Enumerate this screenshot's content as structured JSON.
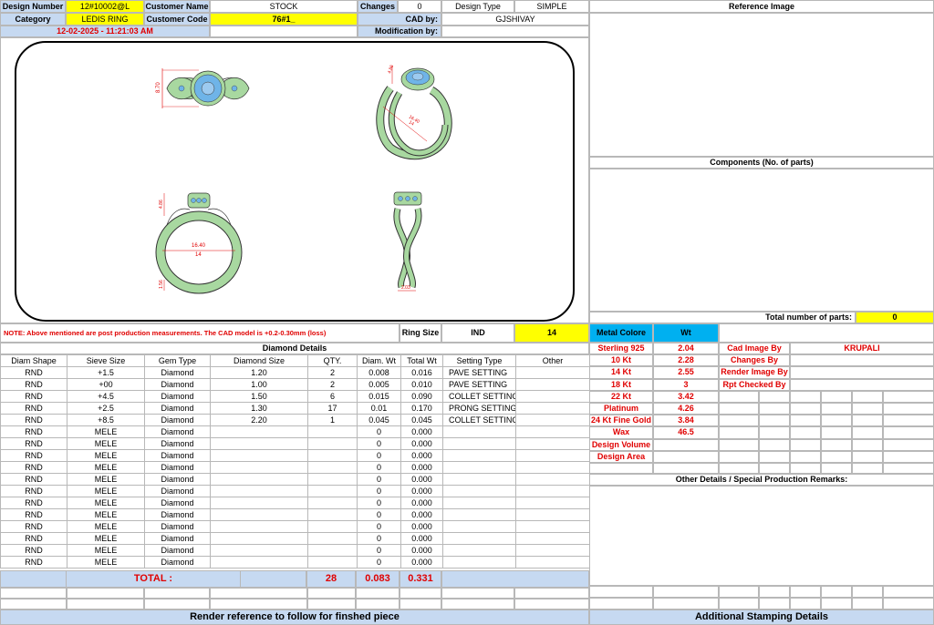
{
  "header": {
    "design_number_label": "Design Number",
    "design_number": "12#10002@L",
    "customer_name_label": "Customer Name",
    "customer_name": "STOCK",
    "changes_label": "Changes",
    "changes": "0",
    "design_type_label": "Design Type",
    "design_type": "SIMPLE",
    "category_label": "Category",
    "category": "LEDIS RING",
    "customer_code_label": "Customer Code",
    "customer_code": "76#1_",
    "cad_by_label": "CAD by:",
    "cad_by": "GJSHIVAY",
    "timestamp": "12-02-2025 - 11:21:03 AM",
    "modification_label": "Modification by:",
    "modification_by": ""
  },
  "right_panel": {
    "reference_image": "Reference Image",
    "components": "Components (No. of parts)",
    "total_parts_label": "Total number of parts:",
    "total_parts": "0",
    "other_details": "Other Details / Special Production Remarks:",
    "additional_stamping": "Additional Stamping Details"
  },
  "dimensions": {
    "top_height": "8.70",
    "side_top": "4.86",
    "side_width_a": "16.40",
    "side_width_b": "14",
    "front_top": "4.86",
    "front_width_a": "16.40",
    "front_width_b": "14",
    "front_bottom": "1.56",
    "profile_bottom": "2.03"
  },
  "ring_size": {
    "note": "NOTE: Above mentioned are post production measurements. The CAD model is +0.2-0.30mm (loss)",
    "label": "Ring Size",
    "standard": "IND",
    "value": "14"
  },
  "metal": {
    "header_label": "Metal Colore",
    "header_wt": "Wt",
    "rows": [
      {
        "name": "Sterling 925",
        "wt": "2.04"
      },
      {
        "name": "10 Kt",
        "wt": "2.28"
      },
      {
        "name": "14 Kt",
        "wt": "2.55"
      },
      {
        "name": "18 Kt",
        "wt": "3"
      },
      {
        "name": "22 Kt",
        "wt": "3.42"
      },
      {
        "name": "Platinum",
        "wt": "4.26"
      },
      {
        "name": "24 Kt Fine Gold",
        "wt": "3.84"
      },
      {
        "name": "Wax",
        "wt": "46.5"
      },
      {
        "name": "Design Volume",
        "wt": ""
      },
      {
        "name": "Design Area",
        "wt": ""
      }
    ]
  },
  "credits": {
    "rows": [
      {
        "label": "Cad Image By",
        "value": "KRUPALI"
      },
      {
        "label": "Changes By",
        "value": ""
      },
      {
        "label": "Render Image By",
        "value": ""
      },
      {
        "label": "Rpt Checked By",
        "value": ""
      }
    ]
  },
  "diamond": {
    "title": "Diamond Details",
    "headers": [
      "Diam Shape",
      "Sieve Size",
      "Gem Type",
      "Diamond Size",
      "QTY.",
      "Diam. Wt",
      "Total Wt",
      "Setting Type",
      "Other"
    ],
    "rows": [
      [
        "RND",
        "+1.5",
        "Diamond",
        "1.20",
        "2",
        "0.008",
        "0.016",
        "PAVE SETTING",
        ""
      ],
      [
        "RND",
        "+00",
        "Diamond",
        "1.00",
        "2",
        "0.005",
        "0.010",
        "PAVE SETTING",
        ""
      ],
      [
        "RND",
        "+4.5",
        "Diamond",
        "1.50",
        "6",
        "0.015",
        "0.090",
        "COLLET SETTING",
        ""
      ],
      [
        "RND",
        "+2.5",
        "Diamond",
        "1.30",
        "17",
        "0.01",
        "0.170",
        "PRONG SETTING",
        ""
      ],
      [
        "RND",
        "+8.5",
        "Diamond",
        "2.20",
        "1",
        "0.045",
        "0.045",
        "COLLET SETTING",
        ""
      ],
      [
        "RND",
        "MELE",
        "Diamond",
        "",
        "",
        "0",
        "0.000",
        "",
        ""
      ],
      [
        "RND",
        "MELE",
        "Diamond",
        "",
        "",
        "0",
        "0.000",
        "",
        ""
      ],
      [
        "RND",
        "MELE",
        "Diamond",
        "",
        "",
        "0",
        "0.000",
        "",
        ""
      ],
      [
        "RND",
        "MELE",
        "Diamond",
        "",
        "",
        "0",
        "0.000",
        "",
        ""
      ],
      [
        "RND",
        "MELE",
        "Diamond",
        "",
        "",
        "0",
        "0.000",
        "",
        ""
      ],
      [
        "RND",
        "MELE",
        "Diamond",
        "",
        "",
        "0",
        "0.000",
        "",
        ""
      ],
      [
        "RND",
        "MELE",
        "Diamond",
        "",
        "",
        "0",
        "0.000",
        "",
        ""
      ],
      [
        "RND",
        "MELE",
        "Diamond",
        "",
        "",
        "0",
        "0.000",
        "",
        ""
      ],
      [
        "RND",
        "MELE",
        "Diamond",
        "",
        "",
        "0",
        "0.000",
        "",
        ""
      ],
      [
        "RND",
        "MELE",
        "Diamond",
        "",
        "",
        "0",
        "0.000",
        "",
        ""
      ],
      [
        "RND",
        "MELE",
        "Diamond",
        "",
        "",
        "0",
        "0.000",
        "",
        ""
      ],
      [
        "RND",
        "MELE",
        "Diamond",
        "",
        "",
        "0",
        "0.000",
        "",
        ""
      ]
    ],
    "total_label": "TOTAL :",
    "total_qty": "28",
    "total_diam_wt": "0.083",
    "total_wt": "0.331"
  },
  "footer": {
    "render_reference": "Render reference to follow for finshed piece"
  },
  "colors": {
    "header_blue": "#c6d9f1",
    "highlight_yellow": "#ffff00",
    "metal_cyan": "#00b0f0",
    "label_red": "#e00000",
    "ring_green": "#a8d8a0",
    "stone_blue": "#6fb4e8"
  }
}
